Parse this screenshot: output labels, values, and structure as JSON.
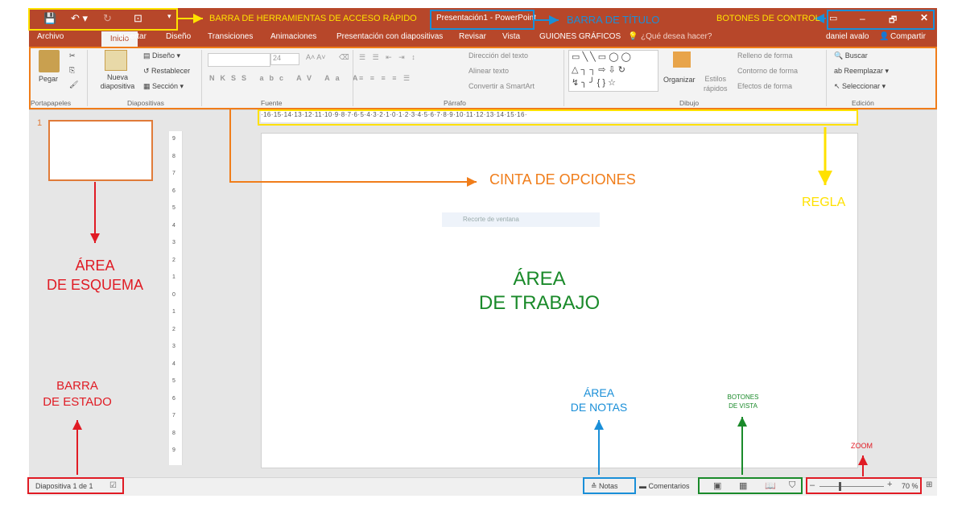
{
  "title_bar": {
    "document_title": "Presentación1 - PowerPoint",
    "window_controls": [
      "–",
      "🗗",
      "✕"
    ]
  },
  "tabs": [
    "Archivo",
    "Inicio",
    "Insertar",
    "Diseño",
    "Transiciones",
    "Animaciones",
    "Presentación con diapositivas",
    "Revisar",
    "Vista",
    "GUIONES GRÁFICOS"
  ],
  "tell_me": "¿Qué desea hacer?",
  "user": "daniel avalo",
  "share": "Compartir",
  "ribbon": {
    "paste": "Pegar",
    "new_slide": "Nueva\ndiapositiva",
    "layout": "Diseño",
    "reset": "Restablecer",
    "section": "Sección",
    "font_size": "24",
    "text_direction": "Dirección del texto",
    "align_text": "Alinear texto",
    "convert_smartart": "Convertir a SmartArt",
    "arrange": "Organizar",
    "quick_styles": "Estilos\nrápidos",
    "shape_fill": "Relleno de forma",
    "shape_outline": "Contorno de forma",
    "shape_effects": "Efectos de forma",
    "find": "Buscar",
    "replace": "Reemplazar",
    "select": "Seleccionar",
    "groups": [
      "Portapapeles",
      "Diapositivas",
      "Fuente",
      "Párrafo",
      "Dibujo",
      "Edición"
    ]
  },
  "ruler": {
    "horizontal": "·16·15·14·13·12·11·10·9·8·7·6·5·4·3·2·1·0·1·2·3·4·5·6·7·8·9·10·11·12·13·14·15·16·",
    "vertical": [
      "9",
      "8",
      "7",
      "6",
      "5",
      "4",
      "3",
      "2",
      "1",
      "0",
      "1",
      "2",
      "3",
      "4",
      "5",
      "6",
      "7",
      "8",
      "9"
    ]
  },
  "slide_number": "1",
  "watermark": "Recorte de ventana",
  "status": {
    "slide_info": "Diapositiva 1 de 1",
    "notes": "Notas",
    "comments": "Comentarios",
    "zoom": "70 %"
  },
  "annotations": {
    "quick_access": "BARRA DE HERRAMIENTAS DE ACCESO RÁPIDO",
    "title_bar": "BARRA DE TÍTULO",
    "control_buttons": "BOTONES DE CONTROL",
    "ribbon": "CINTA DE OPCIONES",
    "ruler": "REGLA",
    "outline_area": [
      "ÁREA",
      "DE ESQUEMA"
    ],
    "work_area": [
      "ÁREA",
      "DE TRABAJO"
    ],
    "status_bar": [
      "BARRA",
      "DE ESTADO"
    ],
    "notes_area": [
      "ÁREA",
      "DE NOTAS"
    ],
    "view_buttons": [
      "BOTONES",
      "DE VISTA"
    ],
    "zoom": "ZOOM"
  },
  "colors": {
    "accent": "#b7472a",
    "yellow": "#ffe100",
    "blue": "#1a8fd8",
    "orange": "#f07d1a",
    "red": "#e01b24",
    "green": "#1a8a2a"
  }
}
